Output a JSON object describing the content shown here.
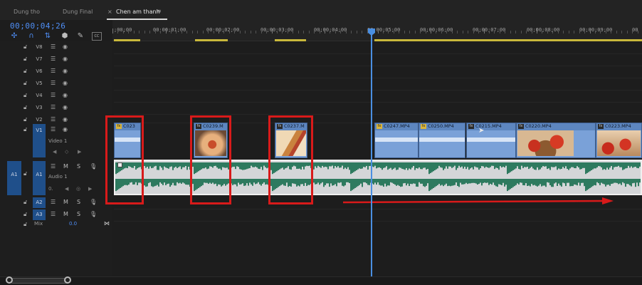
{
  "tabs": [
    {
      "label": "Dung tho"
    },
    {
      "label": "Dung Final"
    },
    {
      "label": "Chen am thanh"
    }
  ],
  "active_tab_menu": "≡",
  "active_tab_close": "×",
  "timecode": "00;00;04;26",
  "ruler_labels": [
    ";00;00",
    "00;00;01;00",
    "00;00;02;00",
    "00;00;03;00",
    "00;00;04;00",
    "00;00;05;00",
    "00;00;06;00",
    "00;00;07;00",
    "00;00;08;00",
    "00;00;09;00",
    "00"
  ],
  "video_tracks": [
    {
      "name": "V8"
    },
    {
      "name": "V7"
    },
    {
      "name": "V6"
    },
    {
      "name": "V5"
    },
    {
      "name": "V4"
    },
    {
      "name": "V3"
    },
    {
      "name": "V2"
    }
  ],
  "v1": {
    "name": "V1",
    "label": "Video 1"
  },
  "a1": {
    "source": "A1",
    "name": "A1",
    "label": "Audio 1",
    "m": "M",
    "s": "S"
  },
  "a2": {
    "name": "A2",
    "m": "M",
    "s": "S"
  },
  "a3": {
    "name": "A3",
    "m": "M",
    "s": "S"
  },
  "mix": {
    "label": "Mix",
    "value": "0.0"
  },
  "clips": [
    {
      "title": "C023"
    },
    {
      "title": "C0239.M"
    },
    {
      "title": "C0237.M"
    },
    {
      "title": "C0247.MP4"
    },
    {
      "title": "C0250.MP4"
    },
    {
      "title": "C0215.MP4"
    },
    {
      "title": "C0220.MP4"
    },
    {
      "title": "C0223.MP4"
    }
  ],
  "colors": {
    "timecode": "#4f8ff7",
    "clip_video": "#7aa1d8",
    "audio_wave": "#2e7a5f",
    "highlight": "#d81a1a",
    "playhead": "#4a8fe2"
  },
  "icons": [
    "snap-icon",
    "linked-selection-icon",
    "add-marker-icon",
    "marker-icon",
    "wrench-icon",
    "captions-icon",
    "lock-icon",
    "sync-lock-icon",
    "eye-icon",
    "mute-icon",
    "solo-icon",
    "mic-icon"
  ]
}
